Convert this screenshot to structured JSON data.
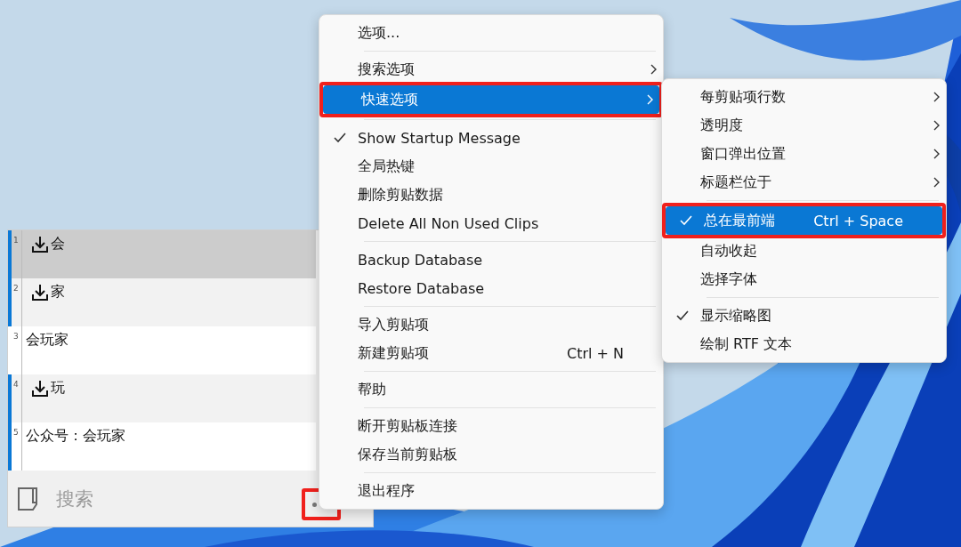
{
  "clip_window": {
    "rows": [
      {
        "number": "1",
        "text": "会",
        "selected": true,
        "accent": true
      },
      {
        "number": "2",
        "text": "家",
        "selected": false,
        "accent": true
      },
      {
        "number": "3",
        "kind": "text",
        "text": "会玩家",
        "selected": false,
        "accent": false
      },
      {
        "number": "4",
        "text": "玩",
        "selected": false,
        "accent": true
      },
      {
        "number": "5",
        "kind": "text",
        "text": "公众号：会玩家",
        "selected": false,
        "accent": true
      }
    ],
    "search": {
      "placeholder": "搜索"
    },
    "grip": {
      "annotated": true
    }
  },
  "context_menu": {
    "items": [
      {
        "kind": "item",
        "label": "选项...",
        "checked": false,
        "submenu": false,
        "selected": false,
        "annotated": false
      },
      {
        "kind": "separator"
      },
      {
        "kind": "item",
        "label": "搜索选项",
        "checked": false,
        "submenu": true,
        "selected": false,
        "annotated": false
      },
      {
        "kind": "item",
        "label": "快速选项",
        "checked": false,
        "submenu": true,
        "selected": true,
        "annotated": true
      },
      {
        "kind": "separator"
      },
      {
        "kind": "item",
        "label": "Show Startup Message",
        "checked": true,
        "submenu": false,
        "selected": false,
        "annotated": false
      },
      {
        "kind": "item",
        "label": "全局热键",
        "checked": false,
        "submenu": false,
        "selected": false,
        "annotated": false
      },
      {
        "kind": "item",
        "label": "删除剪贴数据",
        "checked": false,
        "submenu": false,
        "selected": false,
        "annotated": false
      },
      {
        "kind": "item",
        "label": "Delete All Non Used Clips",
        "checked": false,
        "submenu": false,
        "selected": false,
        "annotated": false
      },
      {
        "kind": "separator"
      },
      {
        "kind": "item",
        "label": "Backup Database",
        "checked": false,
        "submenu": false,
        "selected": false,
        "annotated": false
      },
      {
        "kind": "item",
        "label": "Restore Database",
        "checked": false,
        "submenu": false,
        "selected": false,
        "annotated": false
      },
      {
        "kind": "separator"
      },
      {
        "kind": "item",
        "label": "导入剪贴项",
        "checked": false,
        "submenu": false,
        "selected": false,
        "annotated": false
      },
      {
        "kind": "item",
        "label": "新建剪贴项",
        "shortcut": "Ctrl + N",
        "checked": false,
        "submenu": false,
        "selected": false,
        "annotated": false
      },
      {
        "kind": "separator"
      },
      {
        "kind": "item",
        "label": "帮助",
        "checked": false,
        "submenu": false,
        "selected": false,
        "annotated": false
      },
      {
        "kind": "separator"
      },
      {
        "kind": "item",
        "label": "断开剪贴板连接",
        "checked": false,
        "submenu": false,
        "selected": false,
        "annotated": false
      },
      {
        "kind": "item",
        "label": "保存当前剪贴板",
        "checked": false,
        "submenu": false,
        "selected": false,
        "annotated": false
      },
      {
        "kind": "separator"
      },
      {
        "kind": "item",
        "label": "退出程序",
        "checked": false,
        "submenu": false,
        "selected": false,
        "annotated": false
      }
    ]
  },
  "submenu": {
    "items": [
      {
        "kind": "item",
        "label": "每剪贴项行数",
        "checked": false,
        "submenu": true,
        "selected": false,
        "annotated": false
      },
      {
        "kind": "item",
        "label": "透明度",
        "checked": false,
        "submenu": true,
        "selected": false,
        "annotated": false
      },
      {
        "kind": "item",
        "label": "窗口弹出位置",
        "checked": false,
        "submenu": true,
        "selected": false,
        "annotated": false
      },
      {
        "kind": "item",
        "label": "标题栏位于",
        "checked": false,
        "submenu": true,
        "selected": false,
        "annotated": false
      },
      {
        "kind": "separator"
      },
      {
        "kind": "item",
        "label": "总在最前端",
        "shortcut": "Ctrl + Space",
        "checked": true,
        "submenu": false,
        "selected": true,
        "annotated": true
      },
      {
        "kind": "item",
        "label": "自动收起",
        "checked": false,
        "submenu": false,
        "selected": false,
        "annotated": false
      },
      {
        "kind": "item",
        "label": "选择字体",
        "checked": false,
        "submenu": false,
        "selected": false,
        "annotated": false
      },
      {
        "kind": "separator"
      },
      {
        "kind": "item",
        "label": "显示缩略图",
        "checked": true,
        "submenu": false,
        "selected": false,
        "annotated": false
      },
      {
        "kind": "item",
        "label": "绘制 RTF 文本",
        "checked": false,
        "submenu": false,
        "selected": false,
        "annotated": false
      }
    ]
  }
}
